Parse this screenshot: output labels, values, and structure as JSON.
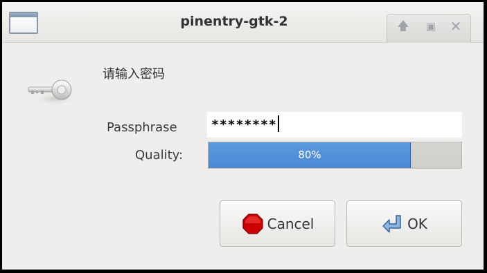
{
  "window": {
    "title": "pinentry-gtk-2",
    "controls": {
      "minimize_icon": "arrow-up-icon",
      "maximize_icon": "maximize-icon",
      "close_icon": "close-icon"
    }
  },
  "dialog": {
    "prompt": "请输入密码",
    "icon": "key-icon",
    "passphrase": {
      "label": "Passphrase",
      "value": "********"
    },
    "quality": {
      "label": "Quality:",
      "percent": 80,
      "text": "80%"
    }
  },
  "buttons": {
    "cancel": {
      "label": "Cancel",
      "icon": "stop-icon",
      "color": "#cc0000"
    },
    "ok": {
      "label": "OK",
      "icon": "return-arrow-icon",
      "color": "#4a88d4"
    }
  },
  "colors": {
    "accent": "#4a88d4",
    "window_bg": "#efeeec"
  }
}
